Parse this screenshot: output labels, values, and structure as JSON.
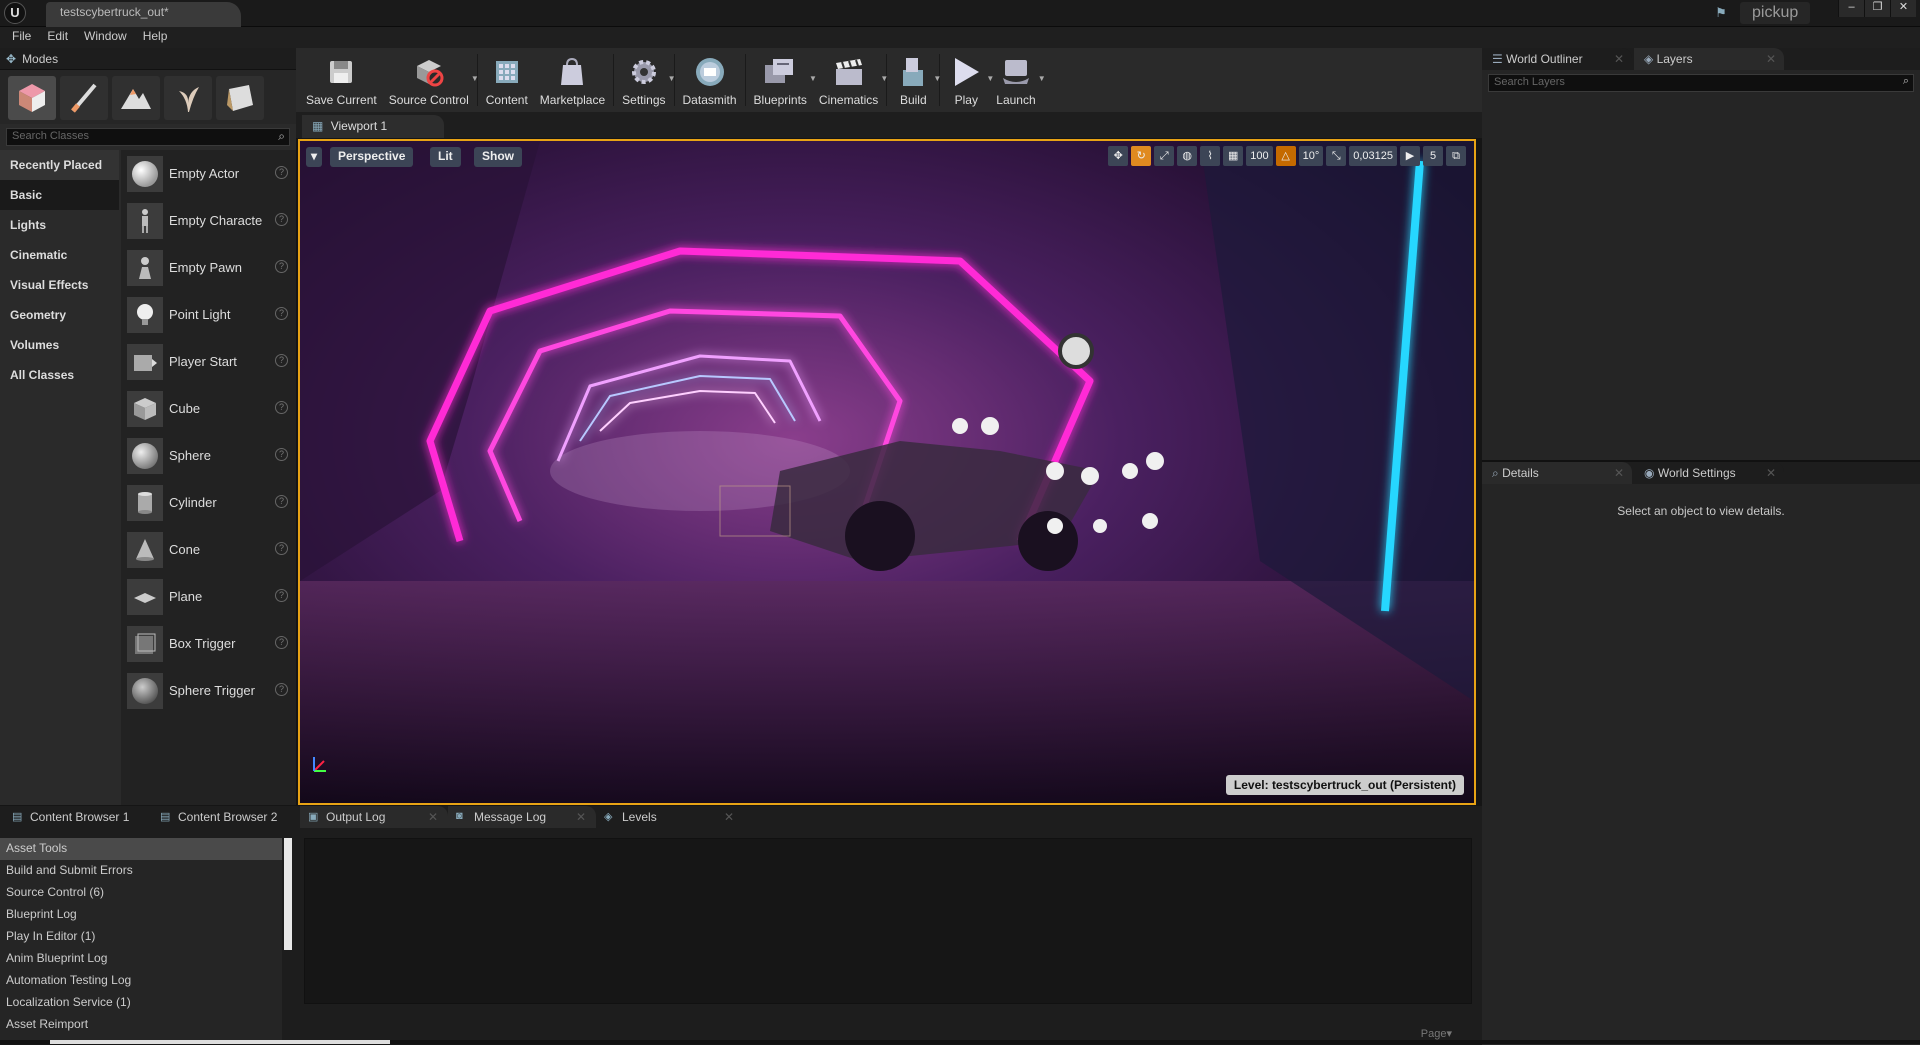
{
  "window": {
    "doc_tab": "testscybertruck_out*",
    "project": "pickup",
    "controls": [
      "‒",
      "❐",
      "✕"
    ]
  },
  "menu": [
    "File",
    "Edit",
    "Window",
    "Help"
  ],
  "modes": {
    "title": "Modes",
    "search_placeholder": "Search Classes",
    "categories": [
      "Recently Placed",
      "Basic",
      "Lights",
      "Cinematic",
      "Visual Effects",
      "Geometry",
      "Volumes",
      "All Classes"
    ],
    "items": [
      "Empty Actor",
      "Empty Characte",
      "Empty Pawn",
      "Point Light",
      "Player Start",
      "Cube",
      "Sphere",
      "Cylinder",
      "Cone",
      "Plane",
      "Box Trigger",
      "Sphere Trigger"
    ],
    "help": "?"
  },
  "toolbar": {
    "save_current": "Save Current",
    "source_control": "Source Control",
    "content": "Content",
    "marketplace": "Marketplace",
    "settings": "Settings",
    "datasmith": "Datasmith",
    "blueprints": "Blueprints",
    "cinematics": "Cinematics",
    "build": "Build",
    "play": "Play",
    "launch": "Launch"
  },
  "viewport": {
    "tab": "Viewport 1",
    "perspective": "Perspective",
    "lit": "Lit",
    "show": "Show",
    "grid_snap": "100",
    "rotation_snap": "10°",
    "scale_snap": "0,03125",
    "camera_speed": "5",
    "level": "Level:  testscybertruck_out (Persistent)"
  },
  "outliner": {
    "tab1": "World Outliner",
    "tab2": "Layers",
    "search_placeholder": "Search Layers"
  },
  "details": {
    "tab1": "Details",
    "tab2": "World Settings",
    "message": "Select an object to view details."
  },
  "bottom": {
    "tabs": [
      "Content Browser 1",
      "Content Browser 2",
      "Output Log",
      "Message Log",
      "Levels"
    ],
    "log_categories": [
      "Asset Tools",
      "Build and Submit Errors",
      "Source Control (6)",
      "Blueprint Log",
      "Play In Editor (1)",
      "Anim Blueprint Log",
      "Automation Testing Log",
      "Localization Service (1)",
      "Asset Reimport"
    ],
    "page": "Page▾"
  },
  "colors": {
    "viewport_border": "#e8a315",
    "neon_pink": "#ff2bd6",
    "neon_blue": "#27d7ff"
  }
}
